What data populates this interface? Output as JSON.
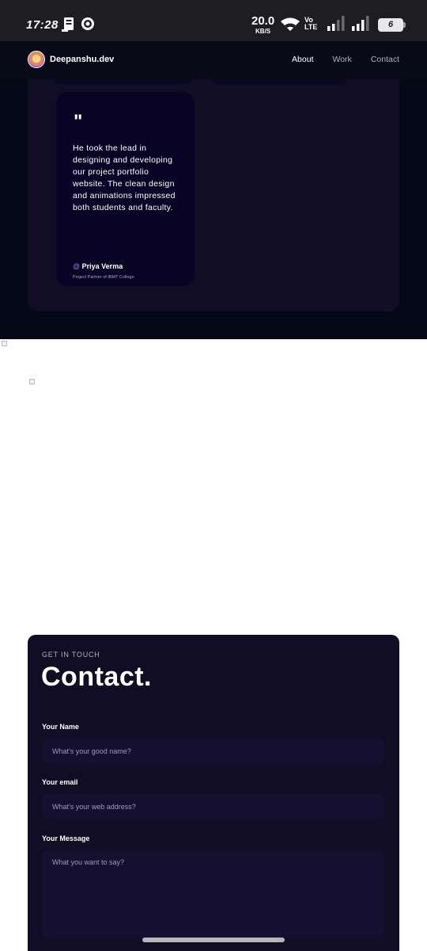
{
  "status_bar": {
    "time": "17:28",
    "net_speed_value": "20.0",
    "net_speed_unit": "KB/S",
    "volte_line1": "Vo",
    "volte_line2": "LTE",
    "battery": "6",
    "icons": [
      "notification-icon",
      "whatsapp-icon",
      "wifi-icon",
      "signal-icon",
      "signal-icon",
      "battery-icon"
    ]
  },
  "navbar": {
    "brand": "Deepanshu.dev",
    "links": [
      "About",
      "Work",
      "Contact"
    ]
  },
  "testimonial": {
    "quote_mark": "\"",
    "text": "He took the lead in designing and developing our project portfolio website. The clean design and animations impressed both students and faculty.",
    "author_prefix": "@",
    "author": "Priya Verma",
    "role": "Project Partner of IBMT College"
  },
  "contact": {
    "eyebrow": "GET IN TOUCH",
    "title": "Contact.",
    "name_label": "Your Name",
    "name_placeholder": "What's your good name?",
    "email_label": "Your email",
    "email_placeholder": "What's your web address?",
    "message_label": "Your Message",
    "message_placeholder": "What you want to say?"
  },
  "colors": {
    "background_dark": "#050816",
    "panel": "#100d25",
    "card": "#090325",
    "accent": "#9a7cf0"
  }
}
